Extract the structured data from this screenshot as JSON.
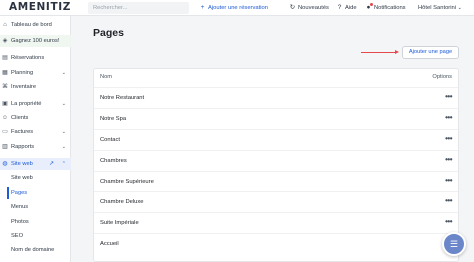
{
  "app": {
    "logo_text": "AMENITIZ"
  },
  "topbar": {
    "search_placeholder": "Rechercher...",
    "add_reservation": "Ajouter une réservation",
    "news": "Nouveautés",
    "help": "Aide",
    "notifications": "Notifications",
    "hotel": "Hôtel Santorini",
    "hotel_chevron": "⌄",
    "icons": {
      "add": "+",
      "news": "↻",
      "help": "?",
      "notifications": "●"
    }
  },
  "sidebar": {
    "items": [
      {
        "label": "Tableau de bord",
        "icon": "⌂"
      },
      {
        "label": "Gagnez 100 euros!",
        "icon": "◈"
      },
      {
        "label": "Réservations",
        "icon": "▤"
      },
      {
        "label": "Planning",
        "icon": "▦",
        "chevron": "⌄"
      },
      {
        "label": "Inventaire",
        "icon": "⌘"
      },
      {
        "label": "La propriété",
        "icon": "▣",
        "chevron": "⌄"
      },
      {
        "label": "Clients",
        "icon": "☺"
      },
      {
        "label": "Factures",
        "icon": "▭",
        "chevron": "⌄"
      },
      {
        "label": "Rapports",
        "icon": "▥",
        "chevron": "⌄"
      },
      {
        "label": "Site web",
        "icon": "◍",
        "chevron": "⌃",
        "external": "↗"
      }
    ],
    "subitems": [
      {
        "label": "Site web"
      },
      {
        "label": "Pages"
      },
      {
        "label": "Menus"
      },
      {
        "label": "Photos"
      },
      {
        "label": "SEO"
      },
      {
        "label": "Nom de domaine"
      }
    ]
  },
  "main": {
    "title": "Pages",
    "add_page_button": "Ajouter une page",
    "table": {
      "columns": {
        "name": "Nom",
        "options": "Options"
      },
      "row_menu": "•••",
      "rows": [
        "Notre Restaurant",
        "Notre Spa",
        "Contact",
        "Chambres",
        "Chambre Supérieure",
        "Chambre Deluxe",
        "Suite Impériale",
        "Accueil"
      ]
    }
  },
  "help_widget": {
    "icon": "☰"
  },
  "colors": {
    "accent": "#1d5bd8",
    "arrow": "#e5484d",
    "active_bg": "#e8eefb"
  }
}
